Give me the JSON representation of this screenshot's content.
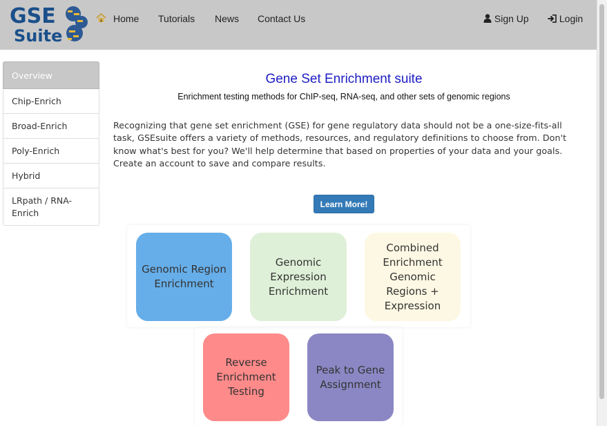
{
  "navbar": {
    "logo_text_1": "GSE",
    "logo_text_2": "Suite",
    "home_icon": "home-icon",
    "items": [
      "Home",
      "Tutorials",
      "News",
      "Contact Us"
    ],
    "sign_up_icon": "user-icon",
    "sign_up": "Sign Up",
    "login_icon": "login-icon",
    "login": "Login"
  },
  "sidebar": {
    "items": [
      {
        "label": "Overview"
      },
      {
        "label": "Chip-Enrich"
      },
      {
        "label": "Broad-Enrich"
      },
      {
        "label": "Poly-Enrich"
      },
      {
        "label": "Hybrid"
      },
      {
        "label": "LRpath / RNA-Enrich"
      }
    ]
  },
  "main": {
    "title": "Gene Set Enrichment suite",
    "subtitle": "Enrichment testing methods for ChIP-seq, RNA-seq, and other sets of genomic regions",
    "description": "Recognizing that gene set enrichment (GSE) for gene regulatory data should not be a one-size-fits-all task, GSEsuite offers a variety of methods, resources, and regulatory definitions to choose from. Don't know what's best for you? We'll help determine that based on properties of your data and your goals. Create an account to save and compare results.",
    "learn_more": "Learn More!",
    "tiles": [
      {
        "label": "Genomic Region Enrichment",
        "color": "#66aee9"
      },
      {
        "label": "Genomic Expression Enrichment",
        "color": "#dff0d8"
      },
      {
        "label": "Combined Enrichment Genomic Regions + Expression",
        "color": "#fdf8e3"
      },
      {
        "label": "Reverse Enrichment Testing",
        "color": "#ff8a8a"
      },
      {
        "label": "Peak to Gene Assignment",
        "color": "#8b87c4"
      }
    ]
  },
  "colors": {
    "navbar_bg": "#c8c8c8",
    "title": "#1d1dc4",
    "button": "#337ab7"
  }
}
